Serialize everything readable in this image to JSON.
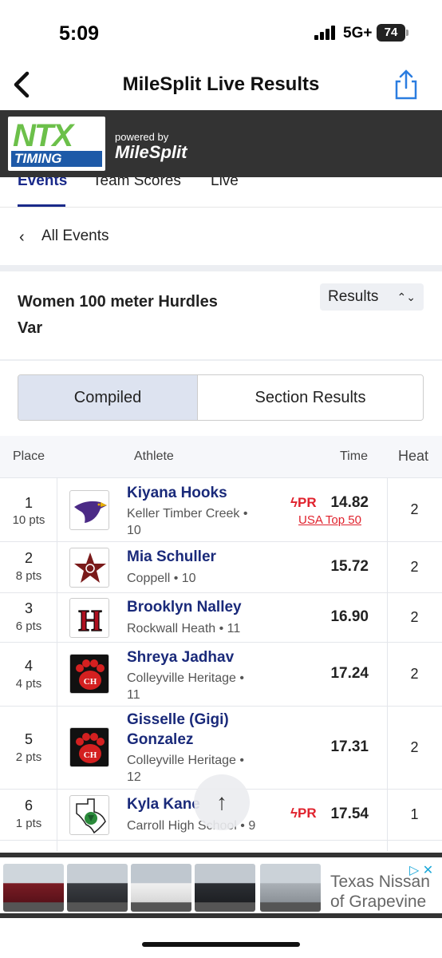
{
  "status_bar": {
    "time": "5:09",
    "network": "5G+",
    "battery": "74"
  },
  "nav": {
    "title": "MileSplit Live Results"
  },
  "banner": {
    "logo_letters": "NTX",
    "logo_sub": "TIMING",
    "powered_by": "powered by",
    "brand": "MileSplit"
  },
  "tabs": [
    {
      "label": "Events",
      "active": true
    },
    {
      "label": "Team Scores",
      "active": false
    },
    {
      "label": "Live",
      "active": false
    }
  ],
  "back_link": "All Events",
  "event": {
    "title_line1": "Women 100 meter Hurdles",
    "title_line2": "Var",
    "view_select": "Results"
  },
  "segments": {
    "compiled": "Compiled",
    "section": "Section Results"
  },
  "table": {
    "headers": {
      "place": "Place",
      "athlete": "Athlete",
      "time": "Time",
      "heat": "Heat"
    },
    "rows": [
      {
        "place": "1",
        "pts": "10 pts",
        "name": "Kiyana Hooks",
        "school": "Keller Timber Creek •",
        "grade": "10",
        "time": "14.82",
        "heat": "2",
        "pr": "PR",
        "badge": "USA Top 50",
        "logo": "purple-bird"
      },
      {
        "place": "2",
        "pts": "8 pts",
        "name": "Mia Schuller",
        "school": "Coppell • 10",
        "time": "15.72",
        "heat": "2",
        "logo": "star-c"
      },
      {
        "place": "3",
        "pts": "6 pts",
        "name": "Brooklyn Nalley",
        "school": "Rockwall Heath • 11",
        "time": "16.90",
        "heat": "2",
        "logo": "letter-h"
      },
      {
        "place": "4",
        "pts": "4 pts",
        "name": "Shreya Jadhav",
        "school": "Colleyville Heritage •",
        "grade": "11",
        "time": "17.24",
        "heat": "2",
        "logo": "paw-ch"
      },
      {
        "place": "5",
        "pts": "2 pts",
        "name_line1": "Gisselle (Gigi)",
        "name_line2": "Gonzalez",
        "school": "Colleyville Heritage •",
        "grade": "12",
        "time": "17.31",
        "heat": "2",
        "logo": "paw-ch"
      },
      {
        "place": "6",
        "pts": "1 pts",
        "name": "Kyla Kane",
        "school": "Carroll High School • 9",
        "time": "17.54",
        "heat": "1",
        "pr": "PR",
        "logo": "texas-dragon"
      }
    ]
  },
  "ad": {
    "line1": "Texas Nissan",
    "line2": "of Grapevine"
  },
  "colors": {
    "accent": "#1a2a8a",
    "pr_red": "#e0222d",
    "banner": "#333333",
    "segment_active": "#dde3f0"
  }
}
